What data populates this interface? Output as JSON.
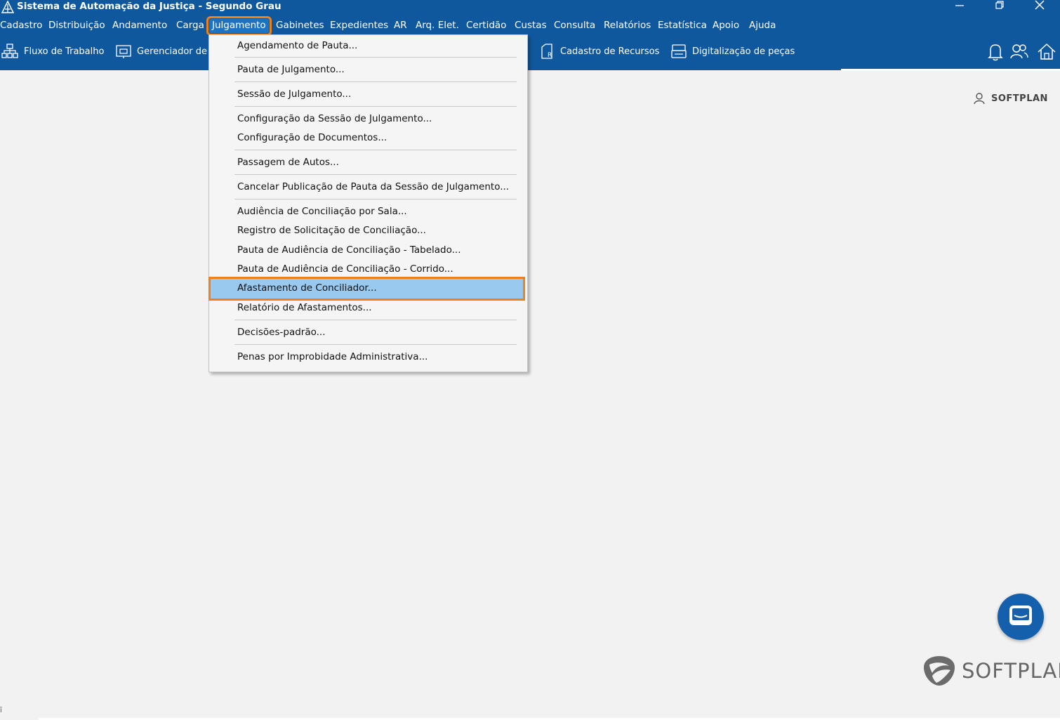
{
  "window": {
    "title": "Sistema de Automação da Justiça - Segundo Grau"
  },
  "menubar": [
    {
      "label": "Cadastro"
    },
    {
      "label": "Distribuição"
    },
    {
      "label": "Andamento"
    },
    {
      "label": "Carga"
    },
    {
      "label": "Julgamento",
      "active": true
    },
    {
      "label": "Gabinetes"
    },
    {
      "label": "Expedientes"
    },
    {
      "label": "AR"
    },
    {
      "label": "Arq. Elet."
    },
    {
      "label": "Certidão"
    },
    {
      "label": "Custas"
    },
    {
      "label": "Consulta"
    },
    {
      "label": "Relatórios"
    },
    {
      "label": "Estatística"
    },
    {
      "label": "Apoio"
    },
    {
      "label": "Ajuda"
    }
  ],
  "toolbar": {
    "fluxo": {
      "label": "Fluxo de Trabalho",
      "icon": "workflow-icon"
    },
    "gerenciador": {
      "label": "Gerenciador de",
      "icon": "folder-monitor-icon"
    },
    "cadastro_recursos": {
      "label": "Cadastro de Recursos",
      "icon": "document-r-icon"
    },
    "digitalizacao": {
      "label": "Digitalização de peças",
      "icon": "scanner-icon"
    },
    "right_icons": [
      "bell-icon",
      "users-icon",
      "home-icon"
    ]
  },
  "dropdown": {
    "items": [
      {
        "label": "Agendamento de Pauta..."
      },
      {
        "label": "Pauta de Julgamento..."
      },
      {
        "label": "Sessão de Julgamento..."
      },
      {
        "label": "Configuração da Sessão de Julgamento..."
      },
      {
        "label": "Configuração de Documentos..."
      },
      {
        "label": "Passagem de Autos..."
      },
      {
        "label": "Cancelar Publicação de Pauta da Sessão de Julgamento..."
      },
      {
        "label": "Audiência de Conciliação por Sala..."
      },
      {
        "label": "Registro de Solicitação de Conciliação..."
      },
      {
        "label": "Pauta de Audiência de Conciliação - Tabelado..."
      },
      {
        "label": "Pauta de Audiência de Conciliação - Corrido..."
      },
      {
        "label": "Afastamento de Conciliador...",
        "highlighted": true
      },
      {
        "label": "Relatório de Afastamentos..."
      },
      {
        "label": "Decisões-padrão..."
      },
      {
        "label": "Penas por Improbidade Administrativa..."
      }
    ]
  },
  "user": {
    "label": "SOFTPLAN",
    "icon": "user-icon"
  },
  "footer": {
    "logo_text": "SOFTPLAN",
    "status_mark": "ī"
  },
  "colors": {
    "header_blue": "#10589e",
    "highlight_blue": "#99c9ef",
    "annotation_orange": "#ee8219",
    "chat_blue": "#1560ad"
  }
}
